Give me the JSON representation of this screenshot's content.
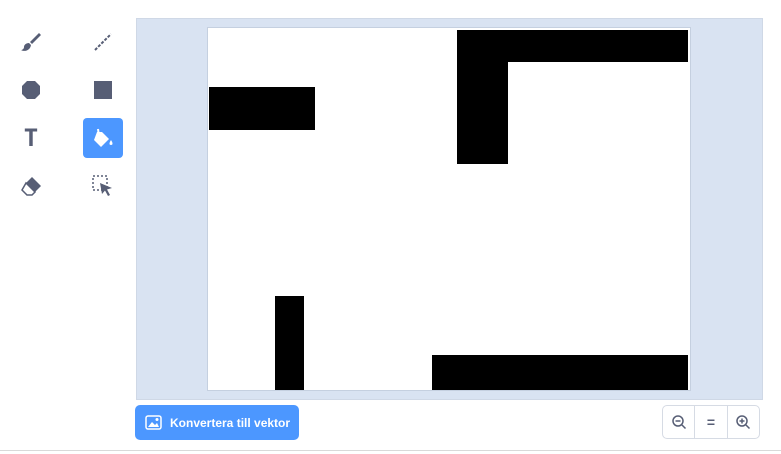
{
  "tools": [
    {
      "name": "brush-tool",
      "icon": "brush-icon",
      "selected": false
    },
    {
      "name": "line-tool",
      "icon": "line-icon",
      "selected": false
    },
    {
      "name": "circle-tool",
      "icon": "circle-icon",
      "selected": false
    },
    {
      "name": "rectangle-tool",
      "icon": "rectangle-icon",
      "selected": false
    },
    {
      "name": "text-tool",
      "icon": "text-icon",
      "selected": false
    },
    {
      "name": "fill-tool",
      "icon": "fill-bucket-icon",
      "selected": true
    },
    {
      "name": "eraser-tool",
      "icon": "eraser-icon",
      "selected": false
    },
    {
      "name": "select-tool",
      "icon": "select-icon",
      "selected": false
    }
  ],
  "text_tool_glyph": "T",
  "convert_button": {
    "label": "Konvertera till vektor",
    "icon": "image-icon"
  },
  "zoom": {
    "zoom_out_icon": "zoom-out-icon",
    "reset_label": "=",
    "zoom_in_icon": "zoom-in-icon"
  },
  "colors": {
    "accent": "#4c97ff",
    "icon": "#575e75",
    "stage_background": "#d9e3f2",
    "shape_fill": "#000000"
  }
}
